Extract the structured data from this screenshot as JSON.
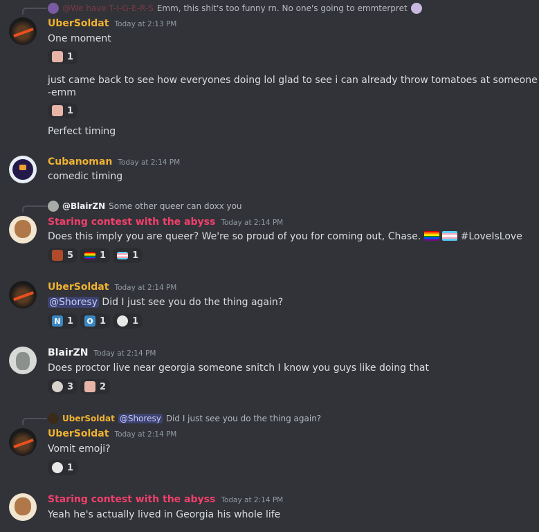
{
  "colors": {
    "background": "#313338",
    "gold_name": "#f0b232",
    "pink_name": "#f23f6c",
    "mention_bg": "#3c4270"
  },
  "messages": [
    {
      "reply": {
        "author": "@We have T-I-G-E-R-S",
        "text": "Emm, this shit's too funny rn. No one's going to emmterpret"
      },
      "username": "UberSoldat",
      "timestamp": "Today at 2:13 PM",
      "lines": [
        "One moment",
        "just came back to see how everyones doing lol glad to see i can already throw tomatoes at someone",
        "-emm",
        "Perfect timing"
      ],
      "reactions": [
        {
          "emoji": "anime-girl-emoji",
          "count": "1"
        },
        {
          "emoji": "anime-girl-emoji",
          "count": "1"
        }
      ]
    },
    {
      "username": "Cubanoman",
      "timestamp": "Today at 2:14 PM",
      "lines": [
        "comedic timing"
      ]
    },
    {
      "reply": {
        "author": "@BlairZN",
        "text": "Some other queer can doxx you"
      },
      "username": "Staring contest with the abyss",
      "timestamp": "Today at 2:14 PM",
      "lines": [
        "Does this imply you are queer? We're so proud of you for coming out, Chase.",
        "#LoveIsLove"
      ],
      "reactions": [
        {
          "emoji": "custom-face-emoji",
          "count": "5"
        },
        {
          "emoji": "rainbow-flag-emoji",
          "count": "1"
        },
        {
          "emoji": "trans-flag-emoji",
          "count": "1"
        }
      ]
    },
    {
      "username": "UberSoldat",
      "timestamp": "Today at 2:14 PM",
      "mention": "@Shoresy",
      "lines": [
        "Did I just see you do the thing again?"
      ],
      "reactions": [
        {
          "emoji": "N",
          "count": "1"
        },
        {
          "emoji": "O",
          "count": "1"
        },
        {
          "emoji": "skull-vomit-emoji",
          "count": "1"
        }
      ]
    },
    {
      "username": "BlairZN",
      "timestamp": "Today at 2:14 PM",
      "lines": [
        "Does proctor live near georgia someone snitch I know you guys like doing that"
      ],
      "reactions": [
        {
          "emoji": "ghost-face-emoji",
          "count": "3"
        },
        {
          "emoji": "anime-girl-emoji",
          "count": "2"
        }
      ]
    },
    {
      "reply": {
        "author": "UberSoldat",
        "mention": "@Shoresy",
        "text": "Did I just see you do the thing again?"
      },
      "username": "UberSoldat",
      "timestamp": "Today at 2:14 PM",
      "lines": [
        "Vomit emoji?"
      ],
      "reactions": [
        {
          "emoji": "skull-vomit-emoji",
          "count": "1"
        }
      ]
    },
    {
      "username": "Staring contest with the abyss",
      "timestamp": "Today at 2:14 PM",
      "lines": [
        "Yeah he's actually lived in Georgia his whole life"
      ]
    }
  ]
}
